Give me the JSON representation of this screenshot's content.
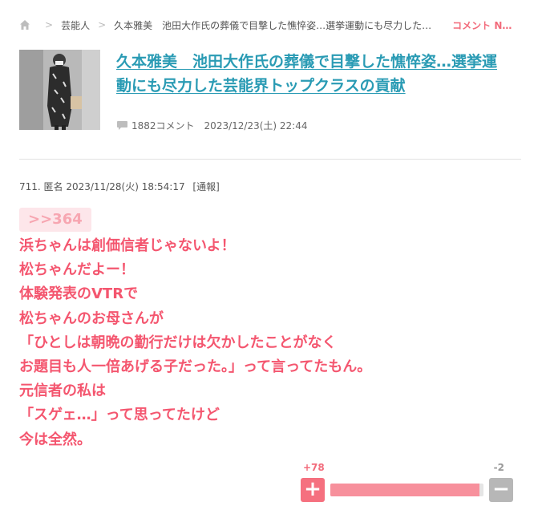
{
  "breadcrumb": {
    "category": "芸能人",
    "current": "久本雅美　池田大作氏の葬儀で目撃した憔悴姿…選挙運動にも尽力した芸…",
    "comment_link": "コメント N…"
  },
  "article": {
    "title_line1": "久本雅美　池田大作氏の葬儀で目撃した憔悴姿…選挙運",
    "title_line2": "動にも尽力した芸能界トップクラスの貢献",
    "comment_count": "1882コメント",
    "date": "2023/12/23(土) 22:44"
  },
  "comment": {
    "header": "711. 匿名 2023/11/28(火) 18:54:17",
    "report_label": "[通報]",
    "anchor": ">>364",
    "lines": [
      "浜ちゃんは創価信者じゃないよ！",
      "松ちゃんだよー！",
      "体験発表のVTRで",
      "松ちゃんのお母さんが",
      "「ひとしは朝晩の勤行だけは欠かしたことがなく",
      "お題目も人一倍あげる子だった。」って言ってたもん。",
      "元信者の私は",
      "「スゲェ…」って思ってたけど",
      "今は全然。"
    ]
  },
  "vote": {
    "plus_count": "+78",
    "minus_count": "-2",
    "plus_symbol": "+",
    "minus_symbol": "−",
    "positive_fraction": 0.975
  },
  "colors": {
    "accent_pink": "#f4566f",
    "link_blue": "#2a9bb4",
    "anchor_bg": "#fde6ea"
  }
}
